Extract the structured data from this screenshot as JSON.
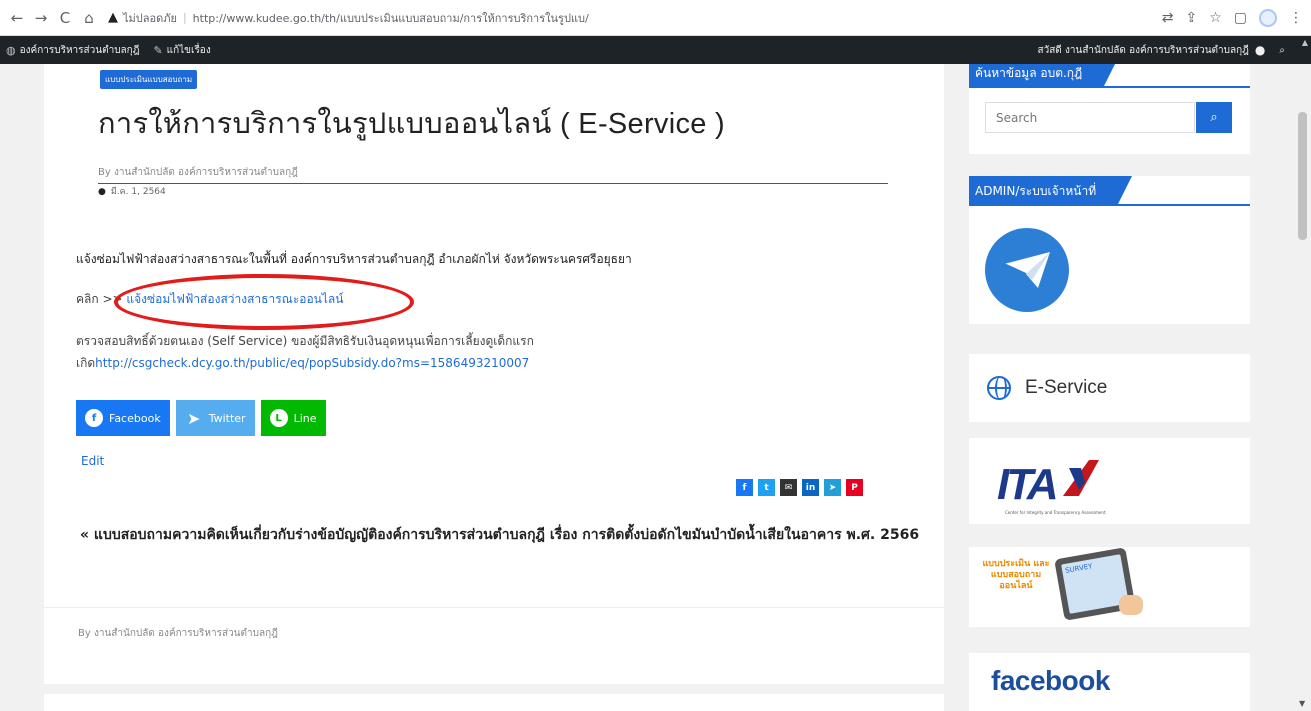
{
  "browser": {
    "back_icon": "←",
    "forward_icon": "→",
    "reload_icon": "C",
    "home_icon": "⌂",
    "warning_icon": "▲",
    "security_label": "ไม่ปลอดภัย",
    "url": "http://www.kudee.go.th/th/แบบประเมินแบบสอบถาม/การให้การบริการในรูปแบ/"
  },
  "adminbar": {
    "site_name": "องค์การบริหารส่วนตำบลกุฎี",
    "edit_label": "แก้ไขเรื่อง",
    "greeting": "สวัสดี งานสำนักปลัด องค์การบริหารส่วนตำบลกุฎี"
  },
  "article": {
    "category": "แบบประเมินแบบสอบถาม",
    "title": "การให้การบริการในรูปแบบออนไลน์ ( E-Service )",
    "byline": "By งานสำนักปลัด องค์การบริหารส่วนตำบลกุฎี",
    "date": "มี.ค. 1, 2564",
    "paragraph1": "แจ้งซ่อมไฟฟ้าส่องสว่างสาธารณะในพื้นที่ องค์การบริหารส่วนตำบลกุฎี อำเภอผักไห่ จังหวัดพระนครศรีอยุธยา",
    "click_prefix": "คลิก >>",
    "click_link": "แจ้งซ่อมไฟฟ้าส่องสว่างสาธารณะออนไลน์",
    "paragraph3_line1": "ตรวจสอบสิทธิ์ด้วยตนเอง (Self Service) ของผู้มีสิทธิรับเงินอุดหนุนเพื่อการเลี้ยงดูเด็กแรก",
    "paragraph3_prefix": "เกิด",
    "paragraph3_link": "http://csgcheck.dcy.go.th/public/eq/popSubsidy.do?ms=1586493210007",
    "share_facebook": "Facebook",
    "share_twitter": "Twitter",
    "share_line": "Line",
    "edit_label": "Edit",
    "prev_post": "« แบบสอบถามความคิดเห็นเกี่ยวกับร่างข้อบัญญัติองค์การบริหารส่วนตำบลกุฎี เรื่อง การติดตั้งบ่อดักไขมันบำบัดน้ำเสียในอาคาร พ.ศ. 2566",
    "footer_byline": "By งานสำนักปลัด องค์การบริหารส่วนตำบลกุฎี"
  },
  "sidebar": {
    "search_title": "ค้นหาข้อมูล อบต.กุฎี",
    "search_placeholder": "Search",
    "admin_title": "ADMIN/ระบบเจ้าหน้าที่",
    "eservice_label": "E-Service",
    "ita_label": "ITA",
    "ita_sub": "Center for Integrity and Transparency Assessment",
    "survey_label": "แบบประเมิน และ แบบสอบถาม ออนไลน์",
    "survey_screen": "SURVEY",
    "facebook_label": "facebook"
  },
  "colors": {
    "accent": "#1e6bd6",
    "highlight": "#e21b1b",
    "facebook": "#1877f2",
    "twitter": "#55acee",
    "line": "#00b900"
  }
}
